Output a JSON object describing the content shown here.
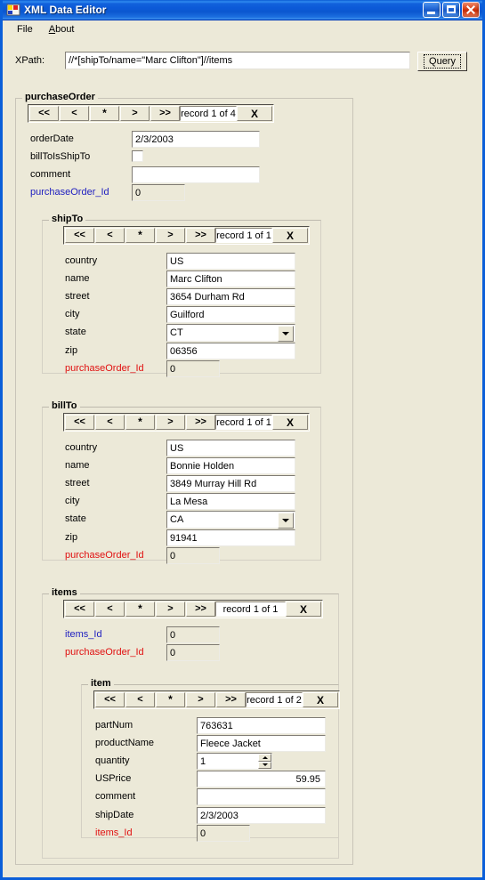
{
  "window": {
    "title": "XML Data Editor",
    "icon": "app-window-icon",
    "buttons": {
      "minimize": "minimize-icon",
      "maximize": "maximize-icon",
      "close": "close-icon"
    }
  },
  "menu": {
    "items": [
      {
        "label": "File"
      },
      {
        "label": "About"
      }
    ]
  },
  "xpath": {
    "label": "XPath:",
    "value": "//*[shipTo/name=\"Marc Clifton\"]//items",
    "placeholder": "",
    "query_button": "Query"
  },
  "nav_buttons": {
    "first": "<<",
    "prev": "<",
    "new": "*",
    "next": ">",
    "last": ">>",
    "delete": "X"
  },
  "colors": {
    "pk_label": "#2020c0",
    "fk_label": "#e01010",
    "window_bg": "#ece9d8",
    "field_bg": "#ffffff",
    "readonly_bg": "#ece9d8"
  },
  "groups": {
    "purchaseOrder": {
      "title": "purchaseOrder",
      "record": "record 1 of 4",
      "fields": [
        {
          "label": "orderDate",
          "value": "2/3/2003",
          "type": "text",
          "key": "none"
        },
        {
          "label": "billToIsShipTo",
          "value": "",
          "type": "checkbox",
          "key": "none",
          "checked": false
        },
        {
          "label": "comment",
          "value": "",
          "type": "text",
          "key": "none"
        },
        {
          "label": "purchaseOrder_Id",
          "value": "0",
          "type": "readonly",
          "key": "pk"
        }
      ]
    },
    "shipTo": {
      "title": "shipTo",
      "record": "record 1 of 1",
      "fields": [
        {
          "label": "country",
          "value": "US",
          "type": "text",
          "key": "none"
        },
        {
          "label": "name",
          "value": "Marc Clifton",
          "type": "text",
          "key": "none"
        },
        {
          "label": "street",
          "value": "3654 Durham Rd",
          "type": "text",
          "key": "none"
        },
        {
          "label": "city",
          "value": "Guilford",
          "type": "text",
          "key": "none"
        },
        {
          "label": "state",
          "value": "CT",
          "type": "combo",
          "key": "none"
        },
        {
          "label": "zip",
          "value": "06356",
          "type": "text",
          "key": "none"
        },
        {
          "label": "purchaseOrder_Id",
          "value": "0",
          "type": "readonly",
          "key": "fk"
        }
      ]
    },
    "billTo": {
      "title": "billTo",
      "record": "record 1 of 1",
      "fields": [
        {
          "label": "country",
          "value": "US",
          "type": "text",
          "key": "none"
        },
        {
          "label": "name",
          "value": "Bonnie Holden",
          "type": "text",
          "key": "none"
        },
        {
          "label": "street",
          "value": "3849 Murray Hill Rd",
          "type": "text",
          "key": "none"
        },
        {
          "label": "city",
          "value": "La Mesa",
          "type": "text",
          "key": "none"
        },
        {
          "label": "state",
          "value": "CA",
          "type": "combo",
          "key": "none"
        },
        {
          "label": "zip",
          "value": "91941",
          "type": "text",
          "key": "none"
        },
        {
          "label": "purchaseOrder_Id",
          "value": "0",
          "type": "readonly",
          "key": "fk"
        }
      ]
    },
    "items": {
      "title": "items",
      "record": "record 1 of 1",
      "fields": [
        {
          "label": "items_Id",
          "value": "0",
          "type": "readonly",
          "key": "pk"
        },
        {
          "label": "purchaseOrder_Id",
          "value": "0",
          "type": "readonly",
          "key": "fk"
        }
      ]
    },
    "item": {
      "title": "item",
      "record": "record 1 of 2",
      "fields": [
        {
          "label": "partNum",
          "value": "763631",
          "type": "text",
          "key": "none"
        },
        {
          "label": "productName",
          "value": "Fleece Jacket",
          "type": "text",
          "key": "none"
        },
        {
          "label": "quantity",
          "value": "1",
          "type": "spinner",
          "key": "none"
        },
        {
          "label": "USPrice",
          "value": "59.95",
          "type": "text-right",
          "key": "none"
        },
        {
          "label": "comment",
          "value": "",
          "type": "text",
          "key": "none"
        },
        {
          "label": "shipDate",
          "value": "2/3/2003",
          "type": "text",
          "key": "none"
        },
        {
          "label": "items_Id",
          "value": "0",
          "type": "readonly",
          "key": "fk"
        }
      ]
    }
  }
}
